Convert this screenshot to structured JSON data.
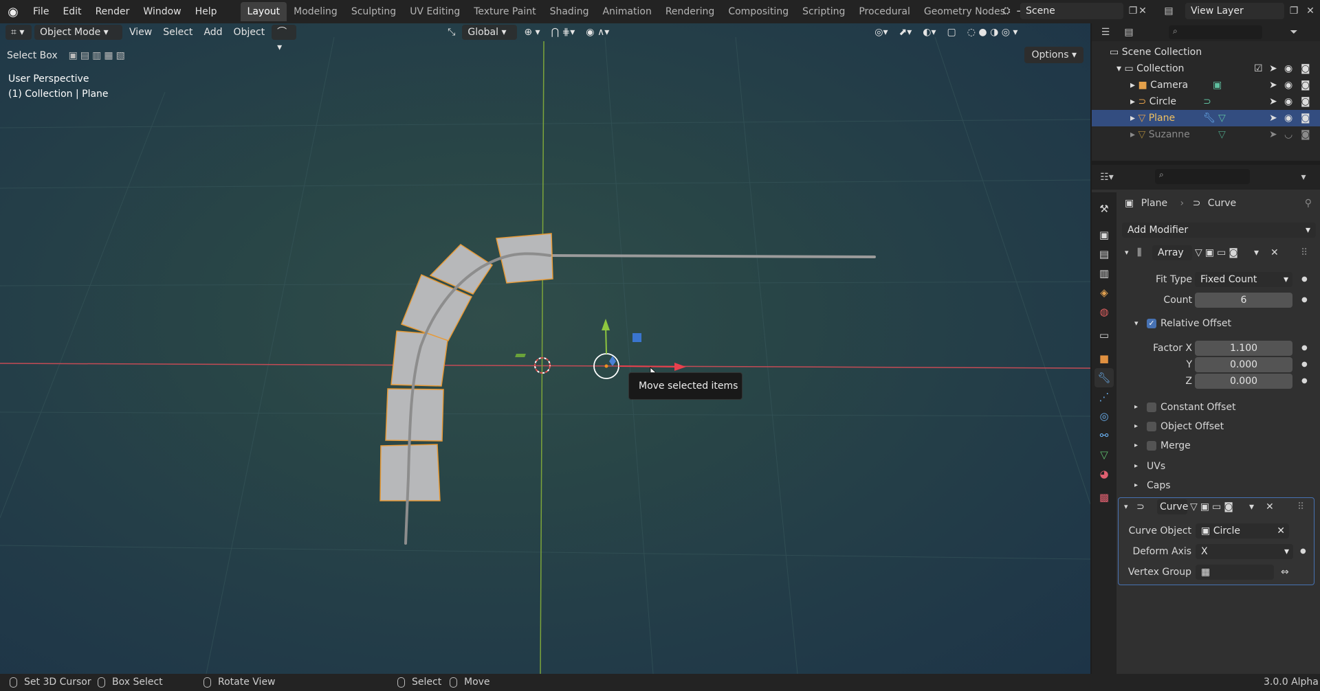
{
  "menu": [
    "File",
    "Edit",
    "Render",
    "Window",
    "Help"
  ],
  "workspaces": [
    "Layout",
    "Modeling",
    "Sculpting",
    "UV Editing",
    "Texture Paint",
    "Shading",
    "Animation",
    "Rendering",
    "Compositing",
    "Scripting",
    "Procedural",
    "Geometry Nodes"
  ],
  "scene": "Scene",
  "view_layer": "View Layer",
  "viewport": {
    "mode": "Object Mode",
    "menus": [
      "View",
      "Select",
      "Add",
      "Object"
    ],
    "transform_orientation": "Global",
    "tool_name": "Select Box",
    "options_label": "Options",
    "perspective": "User Perspective",
    "context": "(1) Collection | Plane",
    "tooltip": "Move selected items"
  },
  "outliner": {
    "root": "Scene Collection",
    "collection": "Collection",
    "objects": [
      {
        "name": "Camera",
        "selected": false,
        "dim": false
      },
      {
        "name": "Circle",
        "selected": false,
        "dim": false
      },
      {
        "name": "Plane",
        "selected": true,
        "dim": false
      },
      {
        "name": "Suzanne",
        "selected": false,
        "dim": true
      }
    ]
  },
  "properties": {
    "object_name": "Plane",
    "modifier_ref": "Curve",
    "add_modifier": "Add Modifier",
    "array": {
      "name": "Array",
      "fit_type_label": "Fit Type",
      "fit_type": "Fixed Count",
      "count_label": "Count",
      "count": "6",
      "relative_offset": "Relative Offset",
      "factor_x_label": "Factor X",
      "factor_x": "1.100",
      "y_label": "Y",
      "y": "0.000",
      "z_label": "Z",
      "z": "0.000",
      "constant_offset": "Constant Offset",
      "object_offset": "Object Offset",
      "merge": "Merge",
      "uvs": "UVs",
      "caps": "Caps"
    },
    "curve": {
      "name": "Curve",
      "curve_object_label": "Curve Object",
      "curve_object": "Circle",
      "deform_axis_label": "Deform Axis",
      "deform_axis": "X",
      "vertex_group_label": "Vertex Group"
    }
  },
  "status": {
    "set_cursor": "Set 3D Cursor",
    "box_select": "Box Select",
    "rotate_view": "Rotate View",
    "select": "Select",
    "move": "Move",
    "version": "3.0.0 Alpha"
  }
}
